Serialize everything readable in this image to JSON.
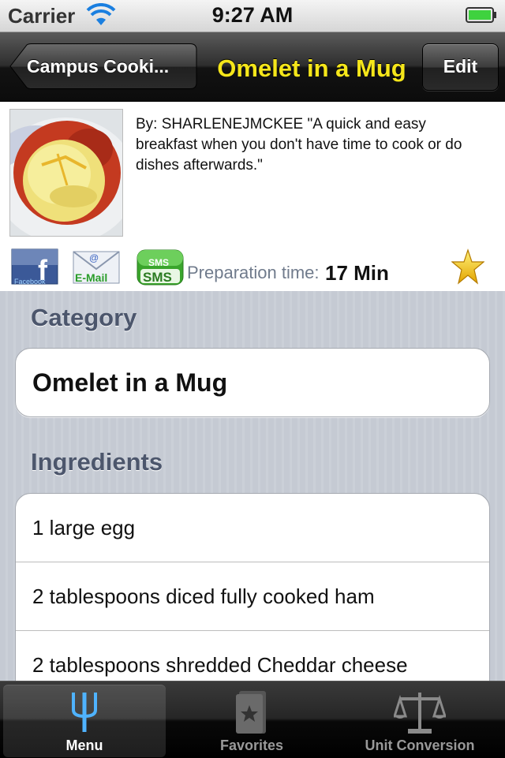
{
  "status_bar": {
    "carrier": "Carrier",
    "time": "9:27 AM"
  },
  "nav": {
    "back_label": "Campus Cooki...",
    "title": "Omelet in a Mug",
    "edit_label": "Edit"
  },
  "recipe": {
    "description": "By:   SHARLENEJMCKEE      \"A quick and easy breakfast when you don't have time to cook or do dishes afterwards.\"",
    "share": {
      "facebook_label": "Facebook",
      "email_label": "E-Mail",
      "sms_badge": "SMS",
      "sms_label": "SMS"
    },
    "prep_label": "Preparation time:",
    "prep_value": "17 Min"
  },
  "sections": {
    "category_header": "Category",
    "category_value": "Omelet in a Mug",
    "ingredients_header": "Ingredients",
    "ingredients": [
      "1 large egg",
      "2 tablespoons diced fully cooked ham",
      "2 tablespoons shredded Cheddar cheese"
    ]
  },
  "tab_bar": {
    "tabs": [
      {
        "label": "Menu",
        "icon": "fork-icon",
        "selected": true
      },
      {
        "label": "Favorites",
        "icon": "star-book-icon",
        "selected": false
      },
      {
        "label": "Unit Conversion",
        "icon": "scale-icon",
        "selected": false
      }
    ]
  },
  "colors": {
    "title_yellow": "#f5e61a",
    "section_header": "#4c566c",
    "prep_label": "#707b8c"
  }
}
